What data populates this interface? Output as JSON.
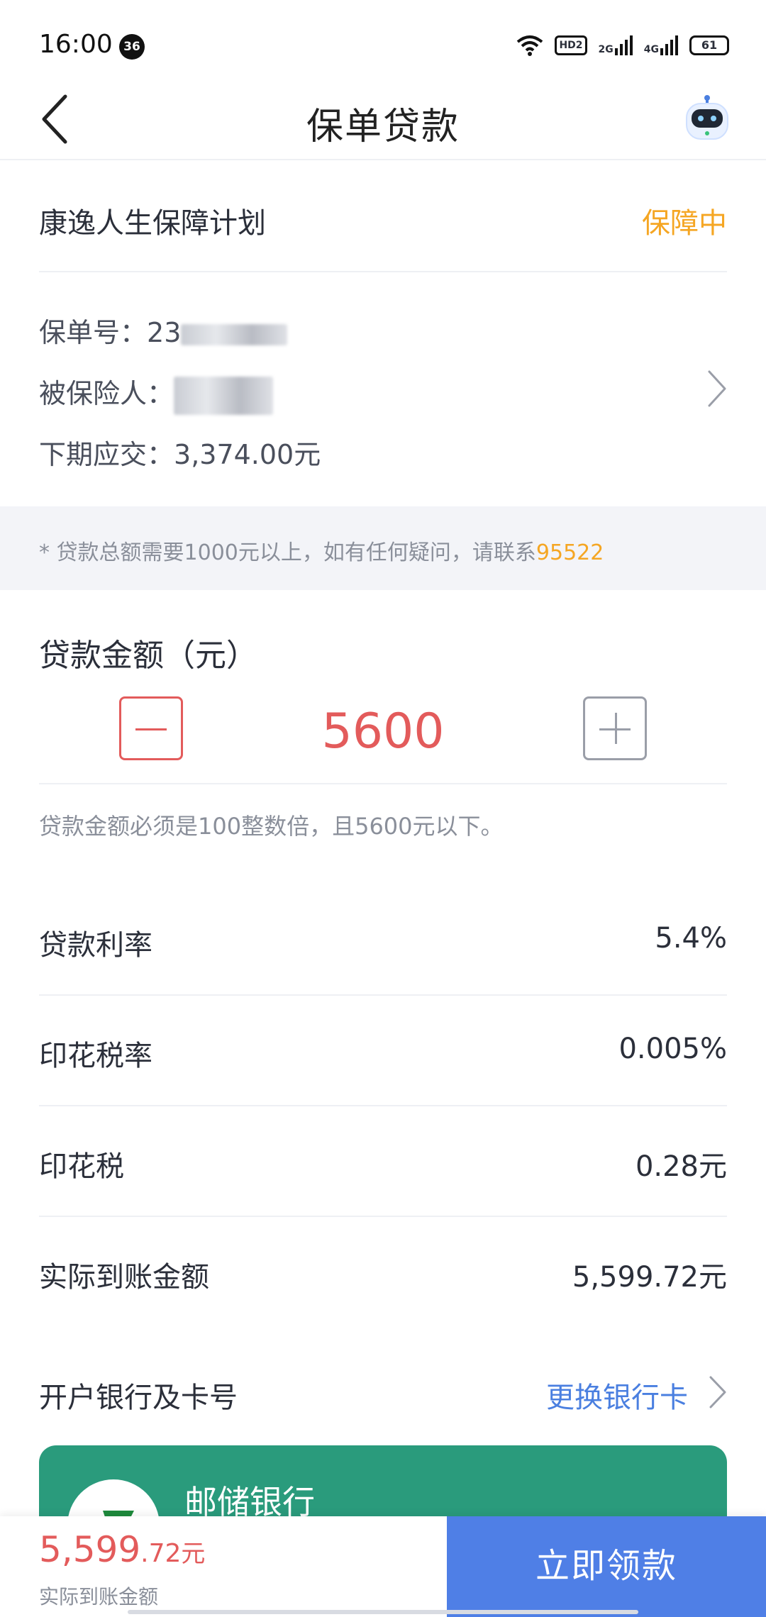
{
  "status_bar": {
    "time": "16:00",
    "notification_count": "36",
    "hd_label": "HD2",
    "network_1": "2G",
    "network_2": "4G",
    "battery": "61"
  },
  "header": {
    "title": "保单贷款",
    "back_icon": "chevron-left-icon",
    "assistant_icon": "robot-icon"
  },
  "policy": {
    "name": "康逸人生保障计划",
    "status": "保障中",
    "number_label": "保单号：",
    "number_visible": "23",
    "insured_label": "被保险人：",
    "next_payment_label": "下期应交：",
    "next_payment_value": "3,374.00元"
  },
  "notice": {
    "text": "* 贷款总额需要1000元以上，如有任何疑问，请联系",
    "phone": "95522"
  },
  "loan": {
    "label": "贷款金额（元）",
    "amount": "5600",
    "hint": "贷款金额必须是100整数倍，且5600元以下。"
  },
  "details": [
    {
      "label": "贷款利率",
      "value": "5.4%"
    },
    {
      "label": "印花税率",
      "value": "0.005%"
    },
    {
      "label": "印花税",
      "value": "0.28元"
    },
    {
      "label": "实际到账金额",
      "value": "5,599.72元"
    }
  ],
  "bank": {
    "label": "开户银行及卡号",
    "change_label": "更换银行卡",
    "bank_name": "邮储银行"
  },
  "footer": {
    "amount_int": "5,599",
    "amount_dec": ".72",
    "amount_unit": "元",
    "caption": "实际到账金额",
    "button_label": "立即领款"
  },
  "colors": {
    "accent_red": "#e35b5b",
    "accent_orange": "#f5a623",
    "link_blue": "#4a7fe0",
    "button_blue": "#4f7fe6",
    "bank_green": "#2a9b7c"
  }
}
